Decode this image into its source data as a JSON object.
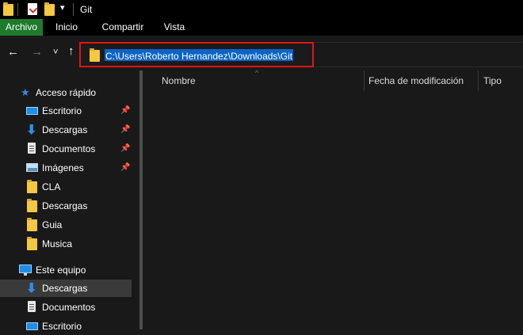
{
  "window": {
    "title": "Git"
  },
  "ribbon": {
    "tabs": [
      {
        "label": "Archivo"
      },
      {
        "label": "Inicio"
      },
      {
        "label": "Compartir"
      },
      {
        "label": "Vista"
      }
    ]
  },
  "address_bar": {
    "path": "C:\\Users\\Roberto Hernandez\\Downloads\\Git"
  },
  "columns": {
    "name": "Nombre",
    "modified": "Fecha de modificación",
    "type": "Tipo"
  },
  "sidebar": {
    "quick_access": {
      "label": "Acceso rápido",
      "items": [
        {
          "label": "Escritorio",
          "icon": "desktop-icon",
          "pinned": true
        },
        {
          "label": "Descargas",
          "icon": "download-icon",
          "pinned": true
        },
        {
          "label": "Documentos",
          "icon": "document-icon",
          "pinned": true
        },
        {
          "label": "Imágenes",
          "icon": "pictures-icon",
          "pinned": true
        },
        {
          "label": "CLA",
          "icon": "folder-icon",
          "pinned": false
        },
        {
          "label": "Descargas",
          "icon": "folder-icon",
          "pinned": false
        },
        {
          "label": "Guia",
          "icon": "folder-icon",
          "pinned": false
        },
        {
          "label": "Musica",
          "icon": "folder-icon",
          "pinned": false
        }
      ]
    },
    "this_pc": {
      "label": "Este equipo",
      "items": [
        {
          "label": "Descargas",
          "icon": "download-icon",
          "selected": true
        },
        {
          "label": "Documentos",
          "icon": "document-icon",
          "selected": false
        },
        {
          "label": "Escritorio",
          "icon": "desktop-icon",
          "selected": false
        }
      ]
    }
  },
  "colors": {
    "accent_tab": "#1e7a2c",
    "selection": "#0a64c8",
    "highlight_box": "#e01414",
    "folder": "#f5c842",
    "star": "#2d8ee8"
  }
}
